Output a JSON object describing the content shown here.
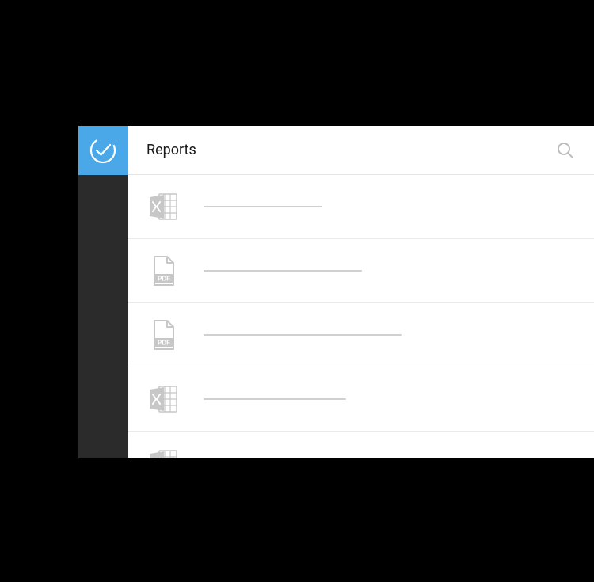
{
  "header": {
    "title": "Reports"
  },
  "items": [
    {
      "type": "excel",
      "placeholder_width": 150
    },
    {
      "type": "pdf",
      "placeholder_width": 200
    },
    {
      "type": "pdf",
      "placeholder_width": 250
    },
    {
      "type": "excel",
      "placeholder_width": 180
    },
    {
      "type": "excel",
      "placeholder_width": 160
    }
  ],
  "colors": {
    "accent": "#4aa7e8",
    "sidebar": "#2b2b2b",
    "icon_gray": "#c7c7c7",
    "line_gray": "#d0d0d0"
  }
}
